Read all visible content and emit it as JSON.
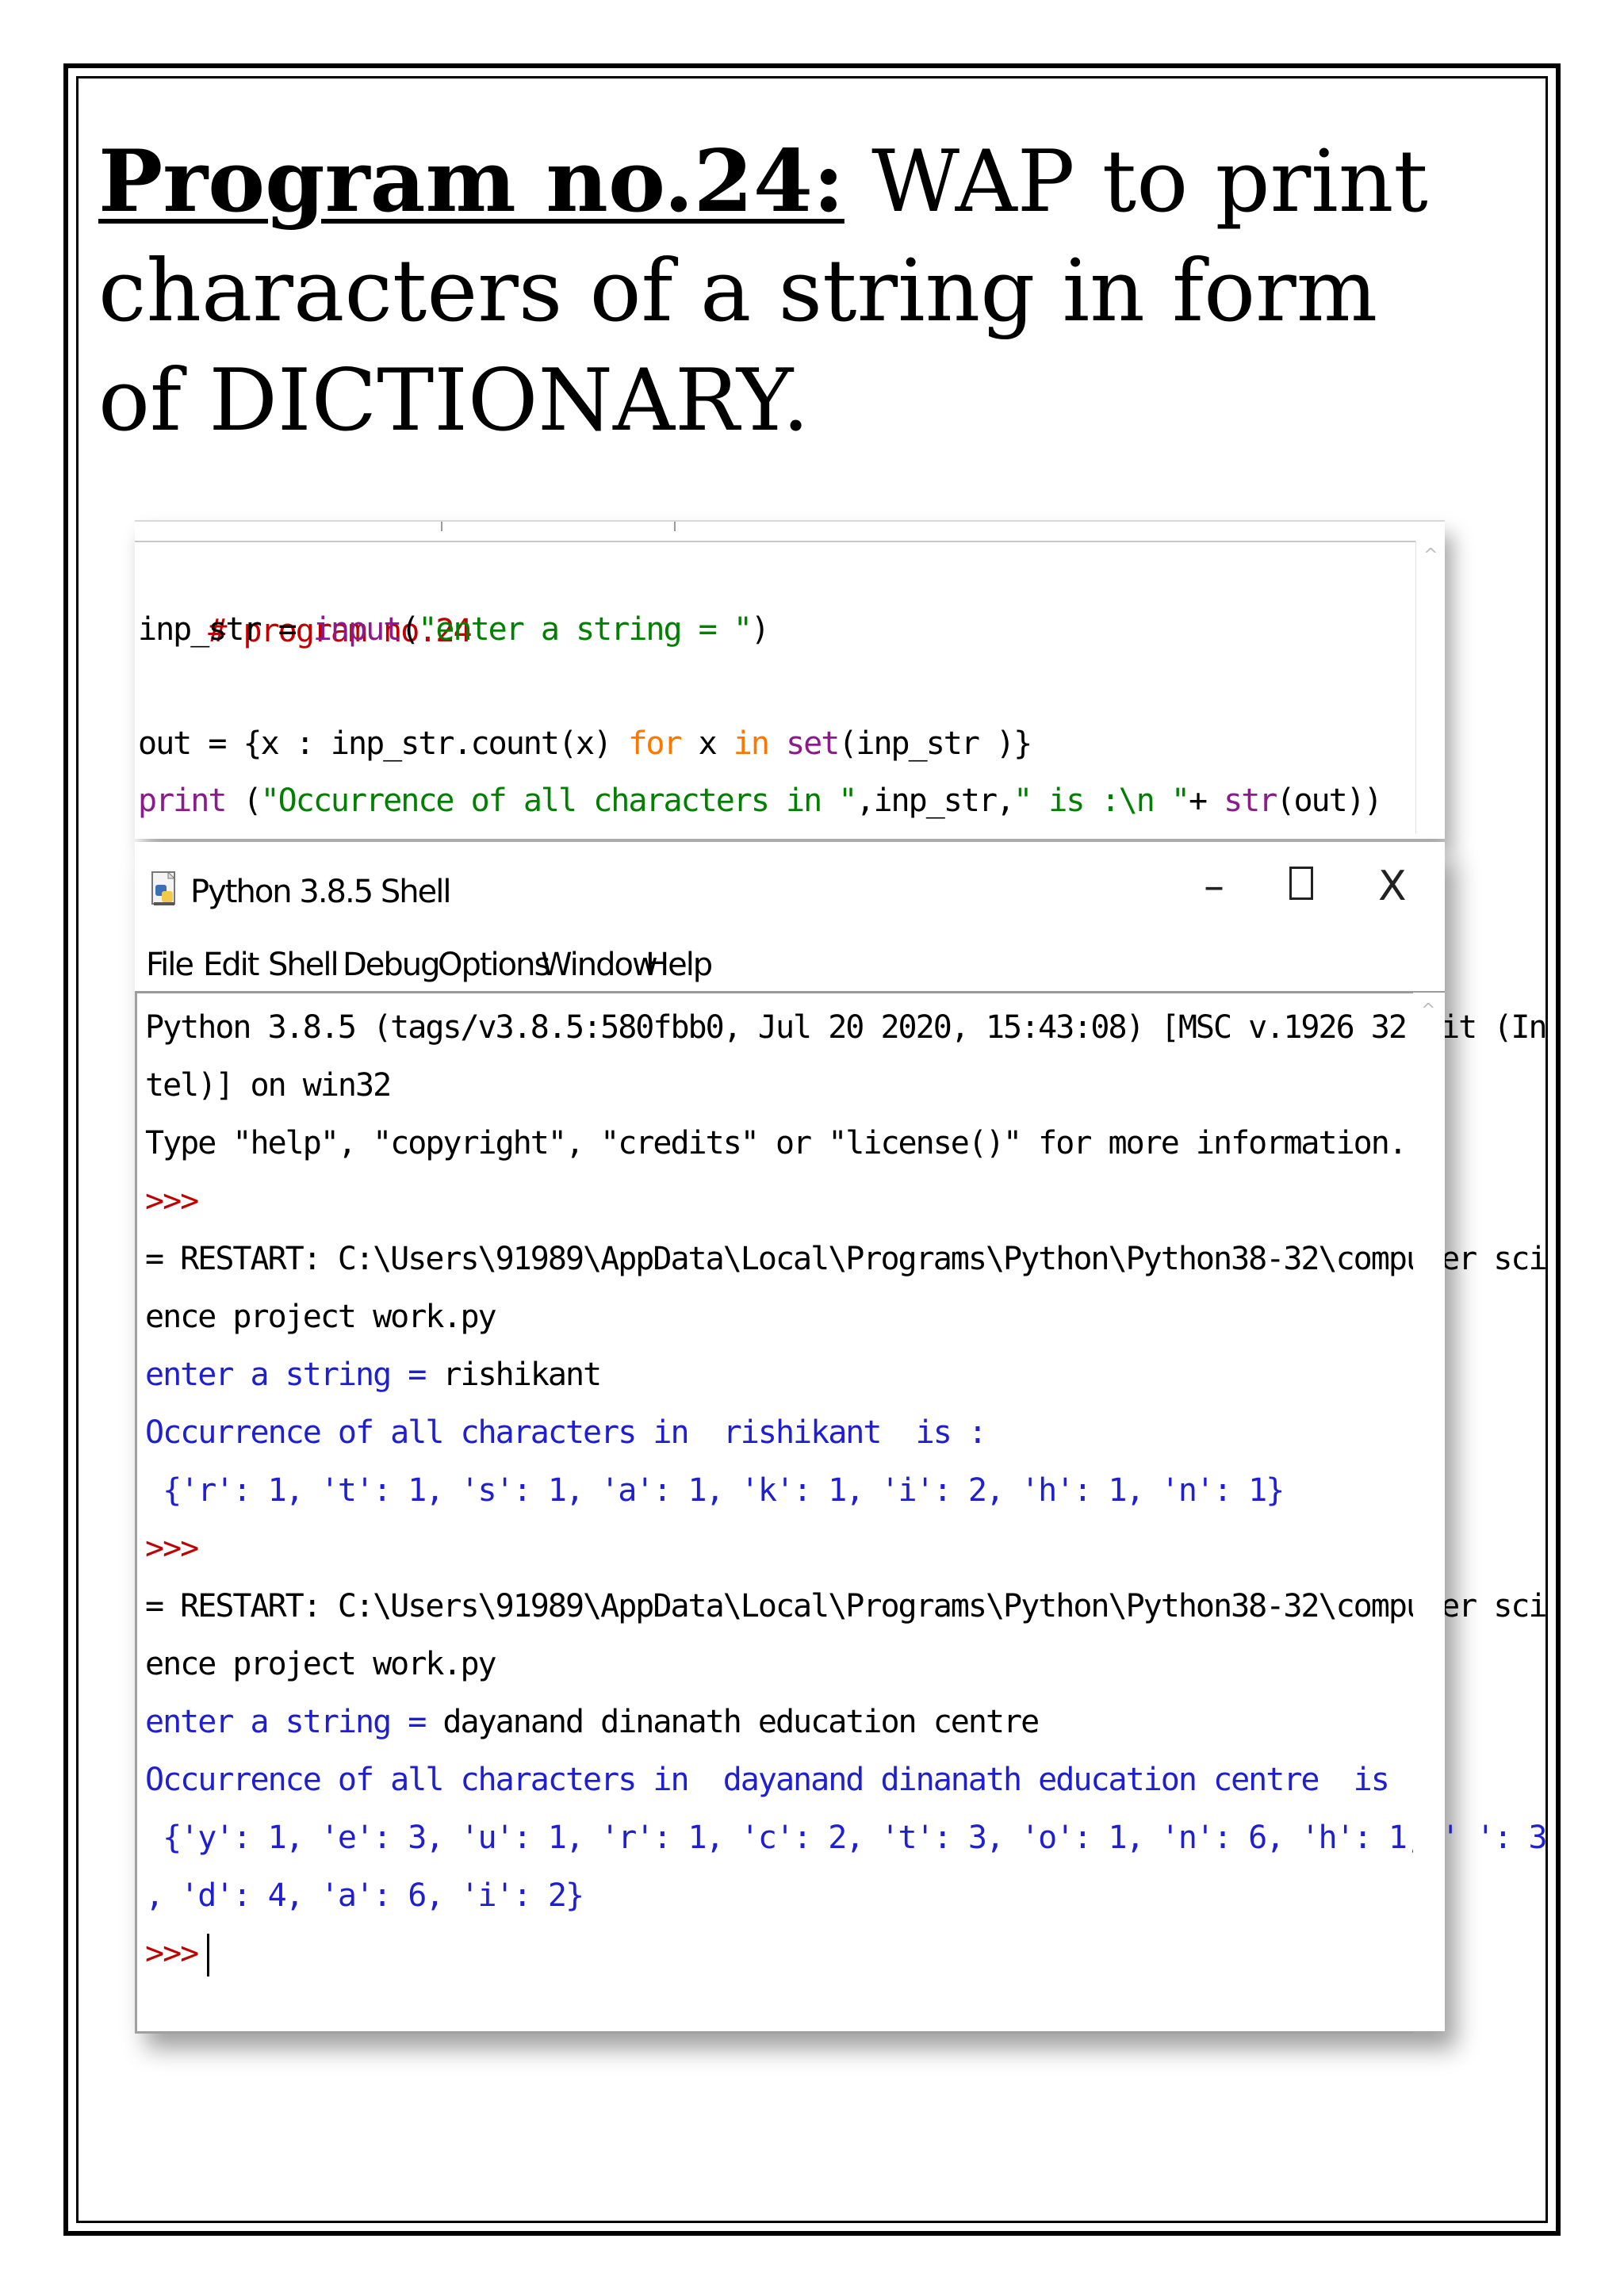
{
  "heading": {
    "prefix": "Program no.24:",
    "text": " WAP to print characters of a string in form of DICTIONARY."
  },
  "editor": {
    "line1": "# program no.24",
    "line2_a": "inp_str = ",
    "line2_b": "input",
    "line2_c": "(",
    "line2_d": "\"enter a string = \"",
    "line2_e": ")",
    "line4_a": "out = {x : inp_str.count(x) ",
    "line4_b": "for",
    "line4_c": " x ",
    "line4_d": "in",
    "line4_e": " ",
    "line4_f": "set",
    "line4_g": "(inp_str )}",
    "line5_a": "print",
    "line5_b": " (",
    "line5_c": "\"Occurrence of all characters in \"",
    "line5_d": ",inp_str,",
    "line5_e": "\" is :\\n \"",
    "line5_f": "+ ",
    "line5_g": "str",
    "line5_h": "(out))"
  },
  "window": {
    "title": "Python 3.8.5 Shell",
    "minimize": "–",
    "close": "X",
    "icon": "python-icon"
  },
  "menu": [
    "File",
    "Edit",
    "Shell",
    "Debug",
    "Options",
    "Window",
    "Help"
  ],
  "shell": {
    "l1": "Python 3.8.5 (tags/v3.8.5:580fbb0, Jul 20 2020, 15:43:08) [MSC v.1926 32 bit (In",
    "l2": "tel)] on win32",
    "l3": "Type \"help\", \"copyright\", \"credits\" or \"license()\" for more information.",
    "prompt": ">>>",
    "restart1a": "= RESTART: C:\\Users\\91989\\AppData\\Local\\Programs\\Python\\Python38-32\\computer sci",
    "restart1b": "ence project work.py",
    "enter_label": "enter a string = ",
    "input1": "rishikant",
    "occ1": "Occurrence of all characters in  rishikant  is :",
    "dict1": " {'r': 1, 't': 1, 's': 1, 'a': 1, 'k': 1, 'i': 2, 'h': 1, 'n': 1}",
    "restart2a": "= RESTART: C:\\Users\\91989\\AppData\\Local\\Programs\\Python\\Python38-32\\computer sci",
    "restart2b": "ence project work.py",
    "input2": "dayanand dinanath education centre",
    "occ2": "Occurrence of all characters in  dayanand dinanath education centre  is :",
    "dict2a": " {'y': 1, 'e': 3, 'u': 1, 'r': 1, 'c': 2, 't': 3, 'o': 1, 'n': 6, 'h': 1, ' ': 3",
    "dict2b": ", 'd': 4, 'a': 6, 'i': 2}"
  },
  "colors": {
    "comment": "#c00000",
    "builtin": "#8b1a8b",
    "string": "#008000",
    "keyword": "#ff7700",
    "stdout": "#1f1fd0"
  }
}
